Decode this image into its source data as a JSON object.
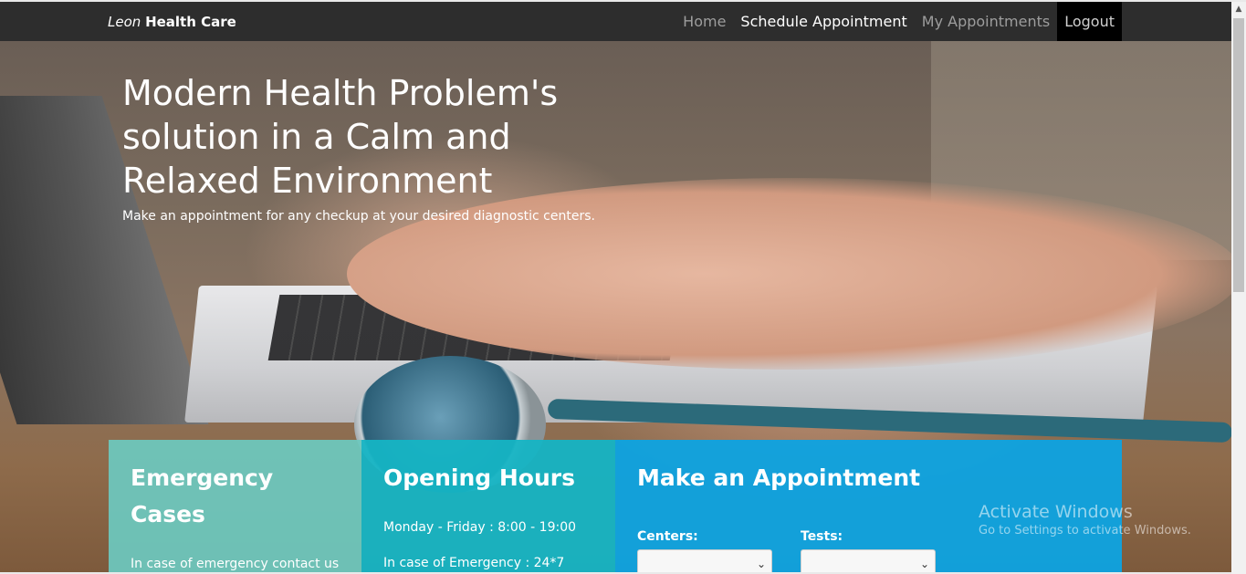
{
  "navbar": {
    "brand_italic": "Leon",
    "brand_bold": "Health Care",
    "items": [
      {
        "label": "Home"
      },
      {
        "label": "Schedule Appointment"
      },
      {
        "label": "My Appointments"
      },
      {
        "label": "Logout"
      }
    ],
    "active_item": "Schedule Appointment"
  },
  "hero": {
    "title": "Modern Health Problem's solution in a Calm and Relaxed Environment",
    "subtitle": "Make an appointment for any checkup at your desired diagnostic centers."
  },
  "panels": {
    "emergency": {
      "title": "Emergency Cases",
      "text": "In case of emergency contact us here"
    },
    "hours": {
      "title": "Opening Hours",
      "line1": "Monday - Friday : 8:00 - 19:00",
      "line2": "In case of Emergency : 24*7"
    },
    "appointment": {
      "title": "Make an Appointment",
      "centers_label": "Centers:",
      "tests_label": "Tests:",
      "centers_value": "",
      "tests_value": ""
    }
  },
  "watermark": {
    "line1": "Activate Windows",
    "line2": "Go to Settings to activate Windows."
  },
  "colors": {
    "navbar": "#2d2d2d",
    "emergency_panel": "#6dc8be",
    "hours_panel": "#15b4c4",
    "appointment_panel": "#0da3e2"
  },
  "icons": [
    "chevron-down-icon",
    "scroll-up-arrow-icon"
  ]
}
